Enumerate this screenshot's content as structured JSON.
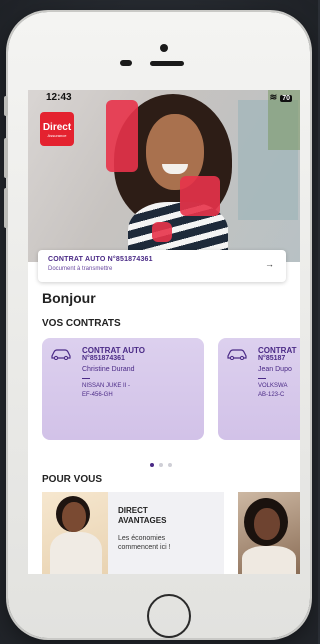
{
  "status_bar": {
    "time": "12:43",
    "battery": "70"
  },
  "brand": {
    "logo_text": "Direct",
    "logo_subtext": "Assurance",
    "accent_color": "#e4222f",
    "primary_color": "#4a2a86"
  },
  "banner": {
    "title": "CONTRAT AUTO N°851874361",
    "subtitle": "Document à transmettre",
    "arrow": "→"
  },
  "greeting": "Bonjour",
  "contracts_section": {
    "title": "VOS CONTRATS",
    "cards": [
      {
        "type": "CONTRAT AUTO",
        "number": "N°851874361",
        "owner": "Christine Durand",
        "vehicle": "NISSAN JUKE II -",
        "plate": "EF-456-GH",
        "icon": "car-icon"
      },
      {
        "type": "CONTRAT",
        "number": "N°85187",
        "owner": "Jean Dupo",
        "vehicle": "VOLKSWA",
        "plate": "AB-123-C",
        "icon": "car-icon"
      }
    ],
    "pagination": {
      "total": 3,
      "active": 1
    }
  },
  "offers_section": {
    "title": "POUR VOUS",
    "promo": {
      "title_line1": "DIRECT",
      "title_line2": "AVANTAGES",
      "text_line1": "Les économies",
      "text_line2": "commencent ici !"
    }
  }
}
